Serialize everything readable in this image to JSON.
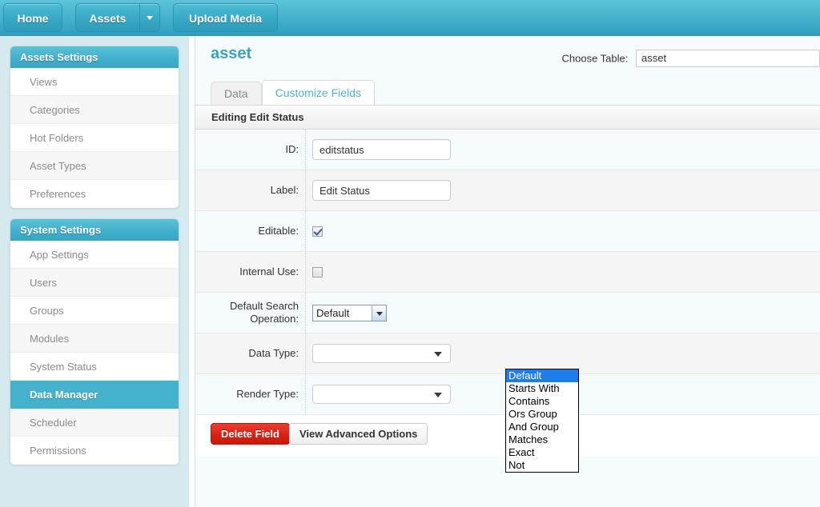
{
  "topbar": {
    "home_label": "Home",
    "assets_label": "Assets",
    "assets_caret_icon": "chevron-down-icon",
    "upload_label": "Upload Media"
  },
  "sidebar": {
    "panels": [
      {
        "title": "Assets Settings",
        "items": [
          {
            "label": "Views",
            "active": false
          },
          {
            "label": "Categories",
            "active": false
          },
          {
            "label": "Hot Folders",
            "active": false
          },
          {
            "label": "Asset Types",
            "active": false
          },
          {
            "label": "Preferences",
            "active": false
          }
        ]
      },
      {
        "title": "System Settings",
        "items": [
          {
            "label": "App Settings",
            "active": false
          },
          {
            "label": "Users",
            "active": false
          },
          {
            "label": "Groups",
            "active": false
          },
          {
            "label": "Modules",
            "active": false
          },
          {
            "label": "System Status",
            "active": false
          },
          {
            "label": "Data Manager",
            "active": true
          },
          {
            "label": "Scheduler",
            "active": false
          },
          {
            "label": "Permissions",
            "active": false
          }
        ]
      }
    ]
  },
  "content": {
    "title": "asset",
    "choose_table": {
      "label": "Choose Table:",
      "value": "asset"
    },
    "tabs": [
      {
        "label": "Data",
        "active": false
      },
      {
        "label": "Customize Fields",
        "active": true
      }
    ],
    "form": {
      "heading": "Editing Edit Status",
      "rows": [
        {
          "label": "ID:",
          "type": "text",
          "value": "editstatus"
        },
        {
          "label": "Label:",
          "type": "text",
          "value": "Edit Status"
        },
        {
          "label": "Editable:",
          "type": "checkbox",
          "checked": true
        },
        {
          "label": "Internal Use:",
          "type": "checkbox",
          "checked": false
        },
        {
          "label_line1": "Default Search",
          "label_line2": "Operation:",
          "type": "select-open",
          "value": "Default"
        },
        {
          "label": "Data Type:",
          "type": "hidden-behind-dropdown"
        },
        {
          "label": "Render Type:",
          "type": "select"
        }
      ],
      "search_operation_options": [
        {
          "label": "Default",
          "selected": true
        },
        {
          "label": "Starts With",
          "selected": false
        },
        {
          "label": "Contains",
          "selected": false
        },
        {
          "label": "Ors Group",
          "selected": false
        },
        {
          "label": "And Group",
          "selected": false
        },
        {
          "label": "Matches",
          "selected": false
        },
        {
          "label": "Exact",
          "selected": false
        },
        {
          "label": "Not",
          "selected": false
        }
      ]
    },
    "buttons": {
      "delete_label": "Delete Field",
      "advanced_label": "View Advanced Options"
    }
  },
  "colors": {
    "brand_teal": "#42b0cc",
    "sidebar_bg": "#d6eaf0",
    "active_item": "#45b2cd",
    "delete_red": "#d92213",
    "dropdown_highlight": "#1f7ceb",
    "title_teal": "#3aa3c4"
  }
}
